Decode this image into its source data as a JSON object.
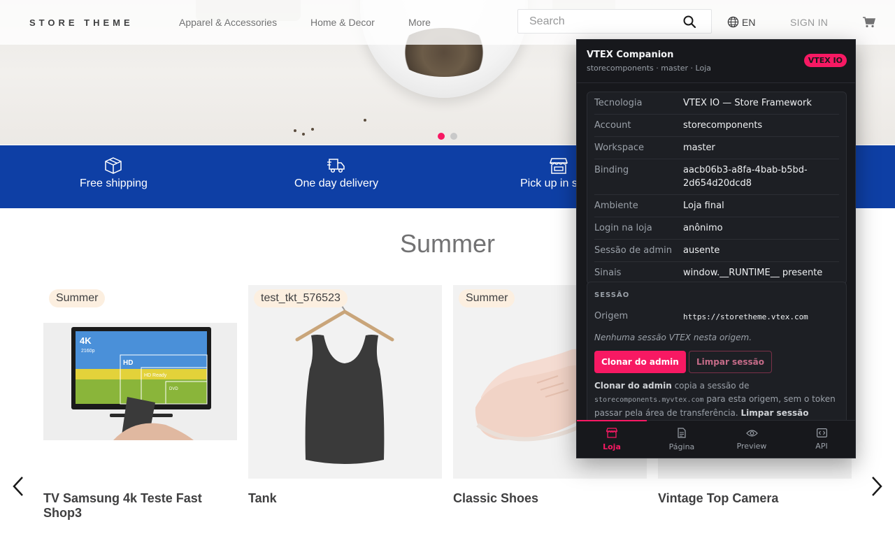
{
  "header": {
    "logo": "STORE THEME",
    "nav": [
      "Apparel & Accessories",
      "Home & Decor",
      "More"
    ],
    "search_placeholder": "Search",
    "language": "EN",
    "sign_in": "SIGN IN"
  },
  "hero": {
    "slide_count": 2,
    "active_slide": 1
  },
  "features": [
    {
      "label": "Free shipping",
      "icon": "box-icon"
    },
    {
      "label": "One day delivery",
      "icon": "truck-icon"
    },
    {
      "label": "Pick up in s",
      "icon": "store-icon"
    }
  ],
  "shelf": {
    "title": "Summer",
    "products": [
      {
        "name": "TV Samsung 4k Teste Fast Shop3",
        "badge": "Summer"
      },
      {
        "name": "Tank",
        "badge": "test_tkt_576523"
      },
      {
        "name": "Classic Shoes",
        "badge": "Summer"
      },
      {
        "name": "Vintage Top Camera",
        "badge": ""
      }
    ]
  },
  "tv_image_text": {
    "k4": "4K",
    "res": "2160p",
    "hd": "HD",
    "hdready": "HD Ready",
    "dvd": "DVD"
  },
  "panel": {
    "title": "VTEX Companion",
    "subtitle": "storecomponents · master · Loja",
    "badge": "VTEX IO",
    "info": [
      {
        "k": "Tecnologia",
        "v": "VTEX IO — Store Framework"
      },
      {
        "k": "Account",
        "v": "storecomponents"
      },
      {
        "k": "Workspace",
        "v": "master"
      },
      {
        "k": "Binding",
        "v": "aacb06b3-a8fa-4bab-b5bd-2d654d20dcd8"
      },
      {
        "k": "Ambiente",
        "v": "Loja final"
      },
      {
        "k": "Login na loja",
        "v": "anônimo"
      },
      {
        "k": "Sessão de admin",
        "v": "ausente"
      },
      {
        "k": "Sinais",
        "v": "window.__RUNTIME__ presente"
      }
    ],
    "session": {
      "label": "SESSÃO",
      "origin_label": "Origem",
      "origin_value": "https://storetheme.vtex.com",
      "empty_text": "Nenhuma sessão VTEX nesta origem.",
      "clone_button": "Clonar do admin",
      "clear_button": "Limpar sessão",
      "desc_bold1": "Clonar do admin",
      "desc_text1": " copia a sessão de ",
      "desc_mono": "storecomponents.myvtex.com",
      "desc_text2": " para esta origem, sem o token passar pela área de transferência. ",
      "desc_bold2": "Limpar sessão"
    },
    "tabs": [
      {
        "label": "Loja",
        "icon": "store-icon",
        "active": true
      },
      {
        "label": "Página",
        "icon": "document-icon",
        "active": false
      },
      {
        "label": "Preview",
        "icon": "eye-icon",
        "active": false
      },
      {
        "label": "API",
        "icon": "code-icon",
        "active": false
      }
    ]
  },
  "colors": {
    "accent": "#f71963",
    "blue_bar": "#0e3fa5",
    "panel_bg": "#17181c",
    "badge_bg": "#fcefe0"
  }
}
